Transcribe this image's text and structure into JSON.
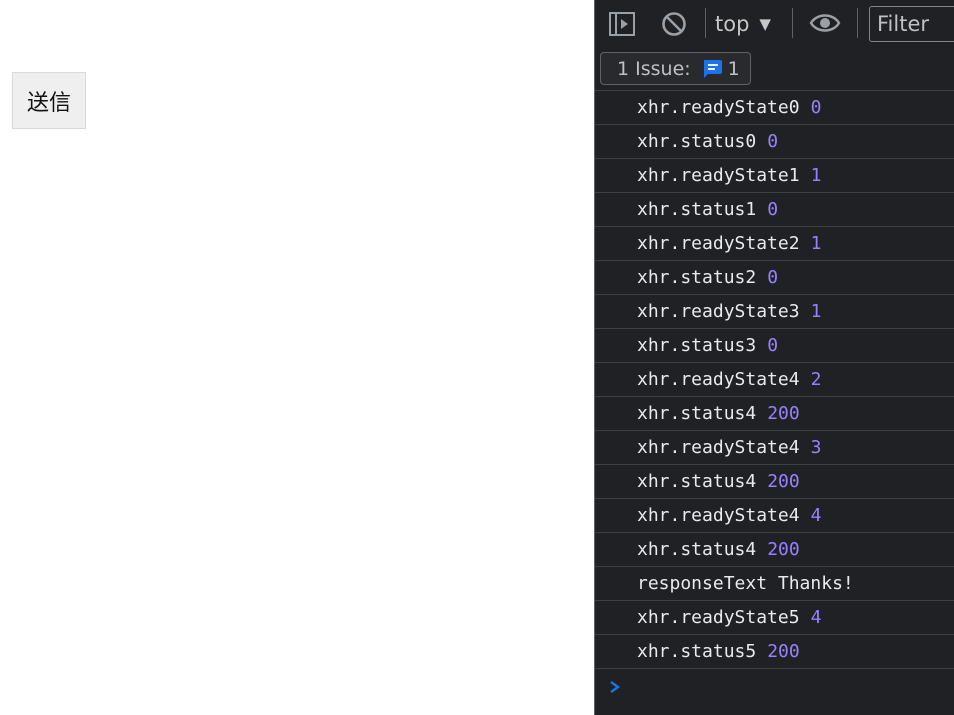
{
  "page": {
    "send_button_label": "送信"
  },
  "devtools": {
    "toolbar": {
      "context_selector": "top",
      "filter_placeholder": "Filter"
    },
    "issues": {
      "label": "1 Issue:",
      "count": "1"
    },
    "console_entries": [
      {
        "text": "xhr.readyState0",
        "value": "0"
      },
      {
        "text": "xhr.status0",
        "value": "0"
      },
      {
        "text": "xhr.readyState1",
        "value": "1"
      },
      {
        "text": "xhr.status1",
        "value": "0"
      },
      {
        "text": "xhr.readyState2",
        "value": "1"
      },
      {
        "text": "xhr.status2",
        "value": "0"
      },
      {
        "text": "xhr.readyState3",
        "value": "1"
      },
      {
        "text": "xhr.status3",
        "value": "0"
      },
      {
        "text": "xhr.readyState4",
        "value": "2"
      },
      {
        "text": "xhr.status4",
        "value": "200"
      },
      {
        "text": "xhr.readyState4",
        "value": "3"
      },
      {
        "text": "xhr.status4",
        "value": "200"
      },
      {
        "text": "xhr.readyState4",
        "value": "4"
      },
      {
        "text": "xhr.status4",
        "value": "200"
      },
      {
        "text": "responseText Thanks!",
        "value": ""
      },
      {
        "text": "xhr.readyState5",
        "value": "4"
      },
      {
        "text": "xhr.status5",
        "value": "200"
      }
    ],
    "colors": {
      "background": "#202124",
      "number": "#9980ff",
      "text": "#e8eaed",
      "prompt": "#1a73e8"
    }
  }
}
